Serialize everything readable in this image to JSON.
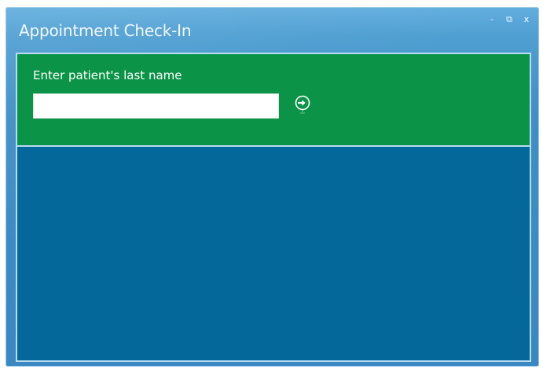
{
  "window": {
    "title": "Appointment Check-In",
    "controls": {
      "minimize": "-",
      "restore": "⧉",
      "close": "x"
    }
  },
  "search": {
    "prompt": "Enter patient's last name",
    "input_value": "",
    "go_icon": "arrow-right-circle-icon"
  },
  "colors": {
    "frame": "#4f9fd2",
    "search_panel": "#0b9447",
    "results_area": "#05689a",
    "inner_border": "#b9dcf1"
  }
}
